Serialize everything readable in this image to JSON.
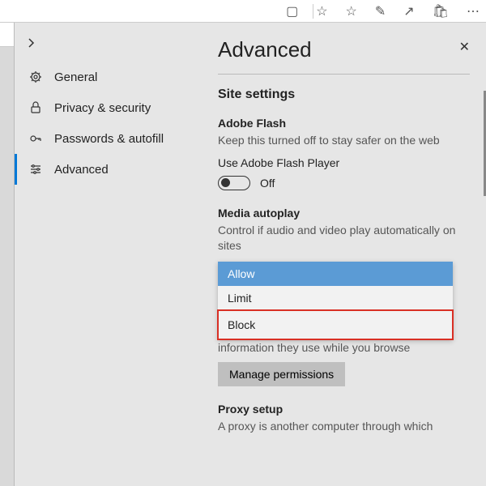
{
  "toolbar": {
    "icons": [
      "reading-list",
      "star-outline",
      "star-add",
      "pen",
      "share",
      "store",
      "more"
    ]
  },
  "sidebar": {
    "items": [
      {
        "label": "General"
      },
      {
        "label": "Privacy & security"
      },
      {
        "label": "Passwords & autofill"
      },
      {
        "label": "Advanced"
      }
    ]
  },
  "page": {
    "title": "Advanced",
    "section_title": "Site settings",
    "flash": {
      "heading": "Adobe Flash",
      "desc": "Keep this turned off to stay safer on the web",
      "use_label": "Use Adobe Flash Player",
      "toggle_state": "Off"
    },
    "autoplay": {
      "heading": "Media autoplay",
      "desc": "Control if audio and video play automatically on sites",
      "options": [
        "Allow",
        "Limit",
        "Block"
      ],
      "under_text": "information they use while you browse",
      "manage_btn": "Manage permissions"
    },
    "proxy": {
      "heading": "Proxy setup",
      "desc": "A proxy is another computer through which"
    }
  }
}
